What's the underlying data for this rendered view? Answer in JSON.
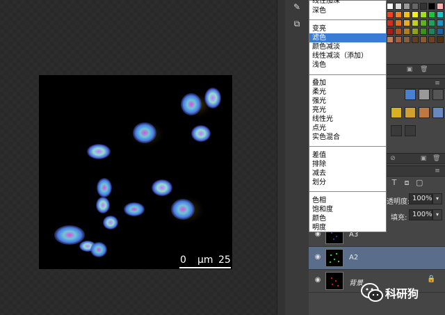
{
  "blend_menu": {
    "items": [
      {
        "label": "线性加深"
      },
      {
        "label": "深色"
      },
      {
        "label": "变亮"
      },
      {
        "label": "滤色",
        "selected": true
      },
      {
        "label": "颜色减淡"
      },
      {
        "label": "线性减淡（添加）"
      },
      {
        "label": "浅色"
      },
      {
        "label": "叠加"
      },
      {
        "label": "柔光"
      },
      {
        "label": "强光"
      },
      {
        "label": "亮光"
      },
      {
        "label": "线性光"
      },
      {
        "label": "点光"
      },
      {
        "label": "实色混合"
      },
      {
        "label": "差值"
      },
      {
        "label": "排除"
      },
      {
        "label": "减去"
      },
      {
        "label": "划分"
      },
      {
        "label": "色相"
      },
      {
        "label": "饱和度"
      },
      {
        "label": "颜色"
      },
      {
        "label": "明度"
      }
    ]
  },
  "layers_panel": {
    "opacity_label": "透明度:",
    "opacity_value": "100%",
    "fill_label": "填充:",
    "fill_value": "100%",
    "layers": [
      {
        "name": "A3",
        "visible": true,
        "selected": false
      },
      {
        "name": "A2",
        "visible": true,
        "selected": true
      },
      {
        "name": "背景",
        "visible": true,
        "selected": false,
        "locked": true
      }
    ]
  },
  "scale_bar": {
    "left": "0",
    "unit": "μm",
    "right": "25"
  },
  "watermark": {
    "text": "科研狗"
  },
  "colors": {
    "selection": "#3a7bd5",
    "selected_layer": "#5a6e8c",
    "panel_bg": "#454545",
    "canvas_bg": "#282828"
  }
}
